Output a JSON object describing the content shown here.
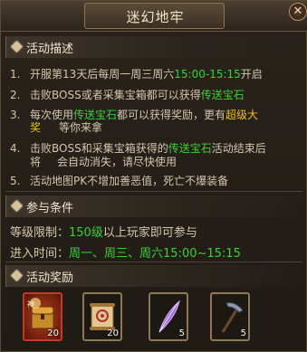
{
  "window": {
    "title": "迷幻地牢",
    "close_icon": "close-icon"
  },
  "description": {
    "heading": "活动描述",
    "items": [
      {
        "num": "1.",
        "parts": [
          "开服第13天后每周一周三周六",
          "15:00-15:15",
          "开启"
        ]
      },
      {
        "num": "2.",
        "parts": [
          "击败BOSS或者采集宝箱都可以获得",
          "传送宝石"
        ]
      },
      {
        "num": "3.",
        "parts": [
          "每次使用",
          "传送宝石",
          "都可以获得奖励，更有",
          "超级大"
        ]
      },
      {
        "num": "",
        "parts": [
          "奖",
          "等你来拿"
        ]
      },
      {
        "num": "4.",
        "parts": [
          "击败BOSS和采集宝箱获得的",
          "传送宝石",
          "活动结束后"
        ]
      },
      {
        "num": "",
        "parts": [
          "将",
          "会自动消失，请尽快使用"
        ]
      },
      {
        "num": "5.",
        "parts": [
          "活动地图PK不增加善恶值，死亡不爆装备"
        ]
      }
    ]
  },
  "conditions": {
    "heading": "参与条件",
    "level_label": "等级限制：",
    "level_value": "150级",
    "level_tail": "以上玩家即可参与",
    "time_label": "进入时间：",
    "time_value": "周一、周三、周六15:00~15:15"
  },
  "rewards": {
    "heading": "活动奖励",
    "items": [
      {
        "name": "divine-chest-icon",
        "count": "20"
      },
      {
        "name": "scroll-icon",
        "count": "20"
      },
      {
        "name": "feather-icon",
        "count": "5"
      },
      {
        "name": "pickaxe-icon",
        "count": "5"
      }
    ]
  },
  "colors": {
    "highlight": "#3ad13a",
    "gold": "#f0c11a",
    "text": "#d4c7ad"
  }
}
